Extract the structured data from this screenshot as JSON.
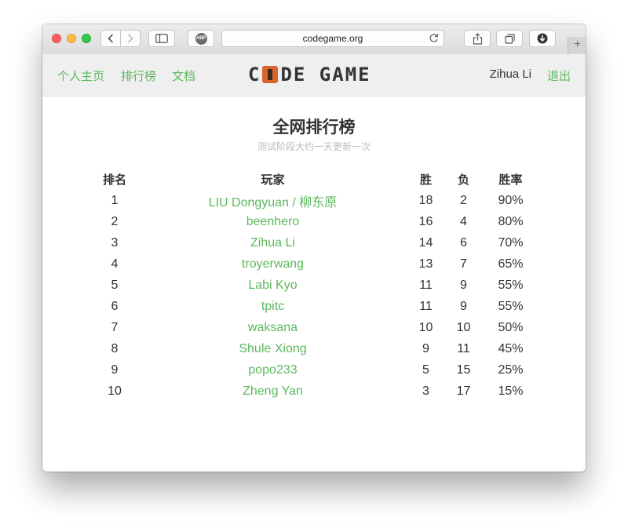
{
  "browser": {
    "url": "codegame.org",
    "abp_label": "ABP"
  },
  "nav": {
    "home": "个人主页",
    "leaderboard": "排行榜",
    "docs": "文档",
    "logo_left": "C",
    "logo_right": "DE GAME",
    "user": "Zihua Li",
    "logout": "退出"
  },
  "page": {
    "title": "全网排行榜",
    "subtitle": "测试阶段大约一天更新一次"
  },
  "table": {
    "headers": {
      "rank": "排名",
      "player": "玩家",
      "wins": "胜",
      "losses": "负",
      "rate": "胜率"
    },
    "rows": [
      {
        "rank": "1",
        "player": "LIU Dongyuan / 柳东原",
        "wins": "18",
        "losses": "2",
        "rate": "90%"
      },
      {
        "rank": "2",
        "player": "beenhero",
        "wins": "16",
        "losses": "4",
        "rate": "80%"
      },
      {
        "rank": "3",
        "player": "Zihua Li",
        "wins": "14",
        "losses": "6",
        "rate": "70%"
      },
      {
        "rank": "4",
        "player": "troyerwang",
        "wins": "13",
        "losses": "7",
        "rate": "65%"
      },
      {
        "rank": "5",
        "player": "Labi Kyo",
        "wins": "11",
        "losses": "9",
        "rate": "55%"
      },
      {
        "rank": "6",
        "player": "tpitc",
        "wins": "11",
        "losses": "9",
        "rate": "55%"
      },
      {
        "rank": "7",
        "player": "waksana",
        "wins": "10",
        "losses": "10",
        "rate": "50%"
      },
      {
        "rank": "8",
        "player": "Shule Xiong",
        "wins": "9",
        "losses": "11",
        "rate": "45%"
      },
      {
        "rank": "9",
        "player": "popo233",
        "wins": "5",
        "losses": "15",
        "rate": "25%"
      },
      {
        "rank": "10",
        "player": "Zheng Yan",
        "wins": "3",
        "losses": "17",
        "rate": "15%"
      }
    ]
  },
  "colors": {
    "link_green": "#5cb85c",
    "logo_orange": "#d8652b",
    "text_dark": "#333333",
    "subtitle_gray": "#bbbbbb",
    "header_bg": "#efefef"
  }
}
